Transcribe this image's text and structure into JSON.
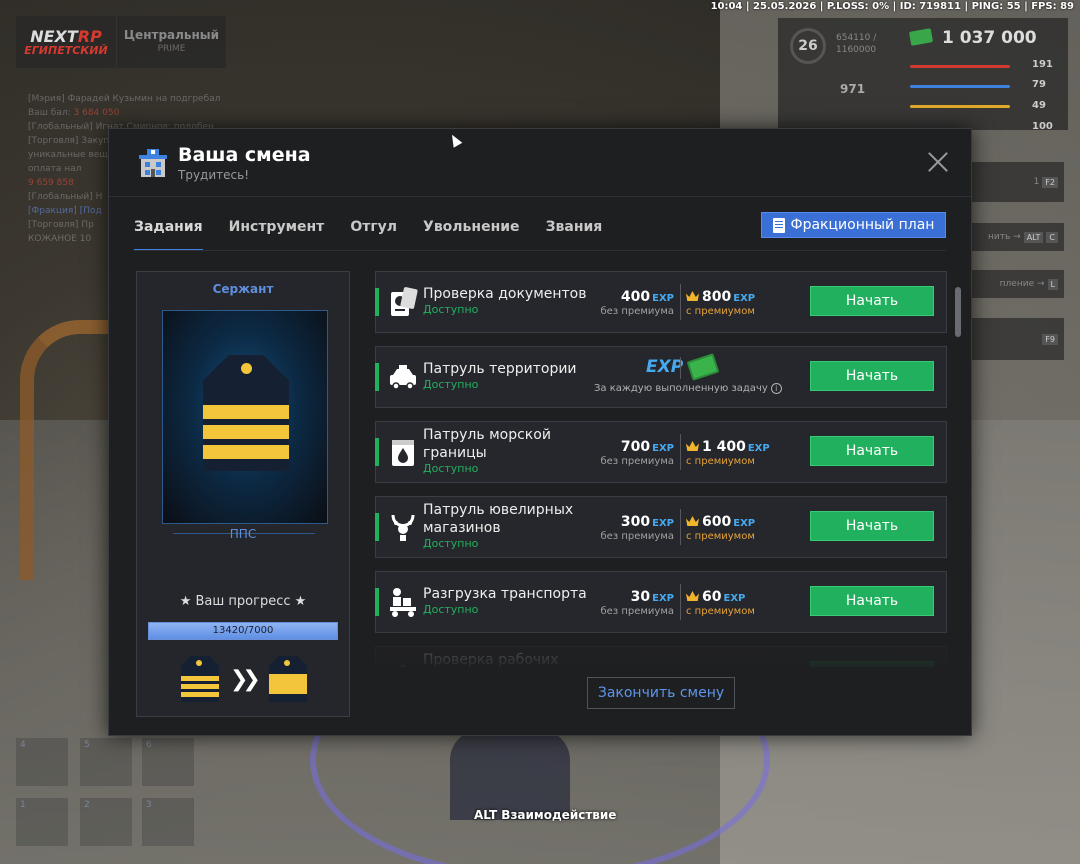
{
  "hud": {
    "status_line": "10:04 | 25.05.2026 | P.LOSS: 0% | ID: 719811 | PING: 55 | FPS: 89",
    "server_name": "Центральный",
    "server_tier": "PRIME",
    "logo_top_a": "NEXT",
    "logo_top_b": "RP",
    "logo_bottom": "ЕГИПЕТСКИЙ",
    "level": "26",
    "exp_current": "654110 /",
    "exp_total": "1160000",
    "stat_971": "971",
    "money": "1 037 000",
    "stat_health": "191",
    "stat_hunger": "79",
    "stat_energy": "49",
    "stat_armor": "100",
    "inventory_count": "1",
    "key_f2": "F2",
    "key_alt": "ALT",
    "key_c": "C",
    "key_l": "L",
    "key_f9": "F9",
    "hint_alt": "нить",
    "hint_l": "пление",
    "hotbar": [
      "4",
      "5",
      "6",
      "1",
      "2",
      "3"
    ],
    "interact_hint": "ALT Взаимодействие"
  },
  "modal": {
    "title": "Ваша смена",
    "subtitle": "Трудитесь!",
    "faction_button": "Фракционный план",
    "tabs": [
      "Задания",
      "Инструмент",
      "Отгул",
      "Увольнение",
      "Звания"
    ],
    "end_shift_button": "Закончить смену"
  },
  "rank": {
    "title": "Сержант",
    "unit": "ППС",
    "progress_label": "★ Ваш прогресс ★",
    "progress_text": "13420/7000",
    "progress_fraction": 1.0
  },
  "tasks": [
    {
      "name_line1": "Проверка документов",
      "name_line2": "",
      "status": "Доступно",
      "exp_base": "400",
      "exp_base_label": "без премиума",
      "exp_premium": "800",
      "exp_premium_label": "с премиумом",
      "exp_unit": "EXP",
      "button": "Начать",
      "icon": "passport-icon"
    },
    {
      "name_line1": "Патруль территории",
      "name_line2": "",
      "status": "Доступно",
      "reward_exp": "EXP",
      "reward_note": "За каждую выполненную задачу",
      "info": "i",
      "button": "Начать",
      "icon": "police-car-icon"
    },
    {
      "name_line1": "Патруль морской",
      "name_line2": "границы",
      "status": "Доступно",
      "exp_base": "700",
      "exp_base_label": "без премиума",
      "exp_premium": "1 400",
      "exp_premium_label": "с премиумом",
      "exp_unit": "EXP",
      "button": "Начать",
      "icon": "water-drop-icon"
    },
    {
      "name_line1": "Патруль ювелирных",
      "name_line2": "магазинов",
      "status": "Доступно",
      "exp_base": "300",
      "exp_base_label": "без премиума",
      "exp_premium": "600",
      "exp_premium_label": "с премиумом",
      "exp_unit": "EXP",
      "button": "Начать",
      "icon": "necklace-icon"
    },
    {
      "name_line1": "Разгрузка транспорта",
      "name_line2": "",
      "status": "Доступно",
      "exp_base": "30",
      "exp_base_label": "без премиума",
      "exp_premium": "60",
      "exp_premium_label": "с премиумом",
      "exp_unit": "EXP",
      "button": "Начать",
      "icon": "loader-truck-icon"
    },
    {
      "name_line1": "Проверка рабочих",
      "name_line2": "",
      "status": "",
      "button": "",
      "icon": "worker-icon"
    }
  ],
  "colors": {
    "accent_green": "#21b15e",
    "accent_blue": "#3a6fd6",
    "exp_blue": "#46aaf0",
    "premium_orange": "#e6a23a",
    "rank_gold": "#f3c53b"
  }
}
